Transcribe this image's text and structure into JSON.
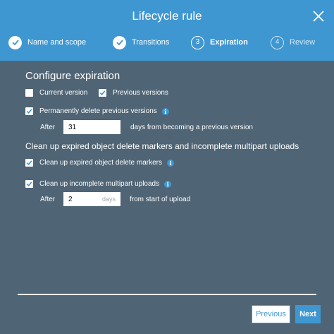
{
  "header": {
    "title": "Lifecycle rule",
    "close_icon": "close-icon"
  },
  "steps": [
    {
      "number": "",
      "label": "Name and scope",
      "state": "done"
    },
    {
      "number": "",
      "label": "Transitions",
      "state": "done"
    },
    {
      "number": "3",
      "label": "Expiration",
      "state": "active"
    },
    {
      "number": "4",
      "label": "Review",
      "state": "inactive"
    }
  ],
  "main": {
    "heading": "Configure expiration",
    "current_version": {
      "label": "Current version",
      "checked": false
    },
    "previous_versions": {
      "label": "Previous versions",
      "checked": true
    },
    "permanently_delete": {
      "label": "Permanently delete previous versions",
      "checked": true
    },
    "after_label": "After",
    "after_value": "31",
    "after_suffix": "days from becoming a previous version",
    "cleanup_heading": "Clean up expired object delete markers and incomplete multipart uploads",
    "cleanup_markers": {
      "label": "Clean up expired object delete markers",
      "checked": true
    },
    "cleanup_multipart": {
      "label": "Clean up incomplete multipart uploads",
      "checked": true
    },
    "after2_label": "After",
    "after2_value": "2",
    "after2_unit": "days",
    "after2_suffix": "from start of upload",
    "info_glyph": "i"
  },
  "footer": {
    "previous_label": "Previous",
    "next_label": "Next"
  },
  "colors": {
    "accent": "#3f97d2",
    "body_bg": "#4f6474"
  }
}
